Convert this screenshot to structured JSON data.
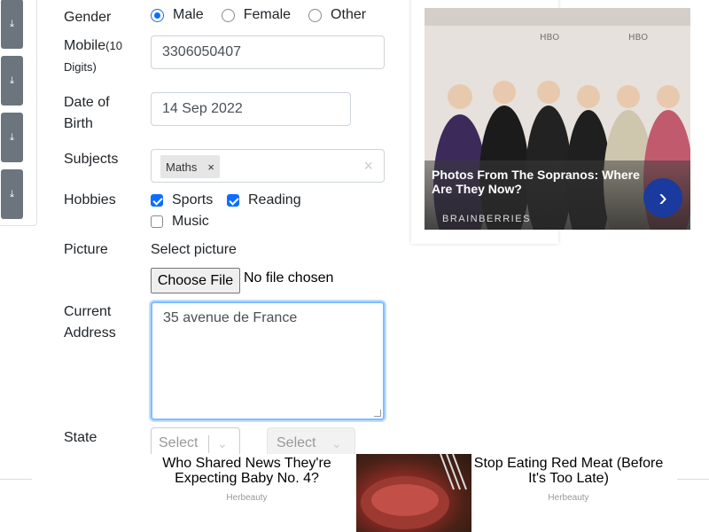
{
  "sidebar": {
    "buttons": [
      "download-icon",
      "download-icon",
      "download-icon",
      "download-icon"
    ]
  },
  "form": {
    "gender": {
      "label": "Gender",
      "options": [
        "Male",
        "Female",
        "Other"
      ],
      "selected": "Male"
    },
    "mobile": {
      "label": "Mobile",
      "label_hint": "(10 Digits)",
      "value": "3306050407"
    },
    "dob": {
      "label": "Date of Birth",
      "value": "14 Sep 2022"
    },
    "subjects": {
      "label": "Subjects",
      "chips": [
        "Maths"
      ],
      "clear_glyph": "×",
      "chip_remove_glyph": "×"
    },
    "hobbies": {
      "label": "Hobbies",
      "options": [
        {
          "label": "Sports",
          "checked": true
        },
        {
          "label": "Reading",
          "checked": true
        },
        {
          "label": "Music",
          "checked": false
        }
      ]
    },
    "picture": {
      "label": "Picture",
      "prompt": "Select picture",
      "button": "Choose File",
      "status": "No file chosen"
    },
    "address": {
      "label": "Current Address",
      "value": "35 avenue de France"
    },
    "state": {
      "label": "State",
      "state_placeholder": "Select State",
      "city_placeholder": "Select City"
    }
  },
  "ad_right": {
    "title": "Photos From The Sopranos: Where Are They Now?",
    "source": "BRAINBERRIES",
    "next_glyph": "›"
  },
  "ad_bottom": {
    "left_title": "Who Shared News They're Expecting Baby No. 4?",
    "left_source": "Herbeauty",
    "right_title": "Stop Eating Red Meat (Before It's Too Late)",
    "right_source": "Herbeauty"
  },
  "colors": {
    "primary": "#0d6efd",
    "focus_border": "#80bdff",
    "sidebar_button": "#6c757d",
    "ad_next": "#1a3a9e"
  }
}
